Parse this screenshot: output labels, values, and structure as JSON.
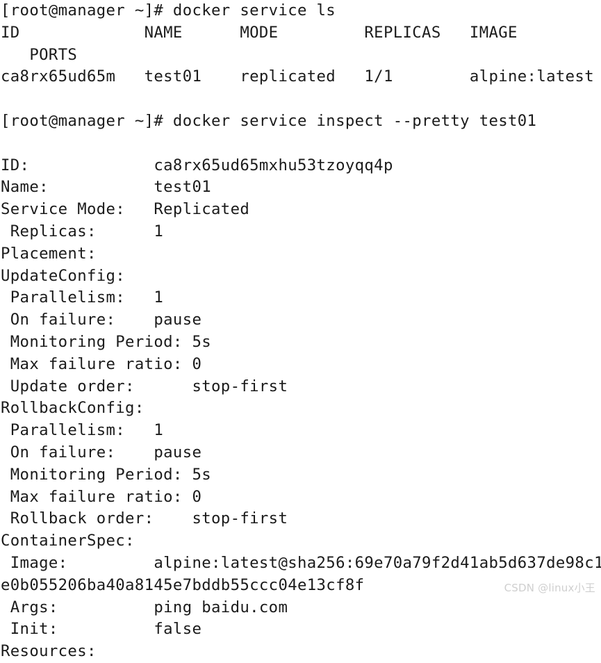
{
  "terminal": {
    "background_color": "#ffffff",
    "text_color": "#1b1b1b",
    "prompt": "[root@manager ~]#",
    "commands": [
      "docker service ls",
      "docker service inspect --pretty test01"
    ],
    "service_ls": {
      "headers": [
        "ID",
        "NAME",
        "MODE",
        "REPLICAS",
        "IMAGE",
        "PORTS"
      ],
      "rows": [
        {
          "id": "ca8rx65ud65m",
          "name": "test01",
          "mode": "replicated",
          "replicas": "1/1",
          "image": "alpine:latest",
          "ports": ""
        }
      ]
    },
    "inspect": {
      "id": "ca8rx65ud65mxhu53tzoyqq4p",
      "name": "test01",
      "service_mode": "Replicated",
      "replicas": "1",
      "placement": "",
      "update_config": {
        "parallelism": "1",
        "on_failure": "pause",
        "monitoring_period": "5s",
        "max_failure_ratio": "0",
        "update_order": "stop-first"
      },
      "rollback_config": {
        "parallelism": "1",
        "on_failure": "pause",
        "monitoring_period": "5s",
        "max_failure_ratio": "0",
        "rollback_order": "stop-first"
      },
      "container_spec": {
        "image": "alpine:latest@sha256:69e70a79f2d41ab5d637de98c1e0b055206ba40a8145e7bddb55ccc04e13cf8f",
        "args": "ping baidu.com",
        "init": "false"
      },
      "resources_label": "Resources:"
    },
    "lines": [
      "[root@manager ~]# docker service ls",
      "ID             NAME      MODE         REPLICAS   IMAGE",
      "   PORTS",
      "ca8rx65ud65m   test01    replicated   1/1        alpine:latest",
      "",
      "[root@manager ~]# docker service inspect --pretty test01",
      "",
      "ID:             ca8rx65ud65mxhu53tzoyqq4p",
      "Name:           test01",
      "Service Mode:   Replicated",
      " Replicas:      1",
      "Placement:",
      "UpdateConfig:",
      " Parallelism:   1",
      " On failure:    pause",
      " Monitoring Period: 5s",
      " Max failure ratio: 0",
      " Update order:      stop-first",
      "RollbackConfig:",
      " Parallelism:   1",
      " On failure:    pause",
      " Monitoring Period: 5s",
      " Max failure ratio: 0",
      " Rollback order:    stop-first",
      "ContainerSpec:",
      " Image:         alpine:latest@sha256:69e70a79f2d41ab5d637de98c1",
      "e0b055206ba40a8145e7bddb55ccc04e13cf8f",
      " Args:          ping baidu.com",
      " Init:          false",
      "Resources:"
    ]
  },
  "watermark": {
    "text": "CSDN @linux小王",
    "color": "#cfcfcf"
  }
}
